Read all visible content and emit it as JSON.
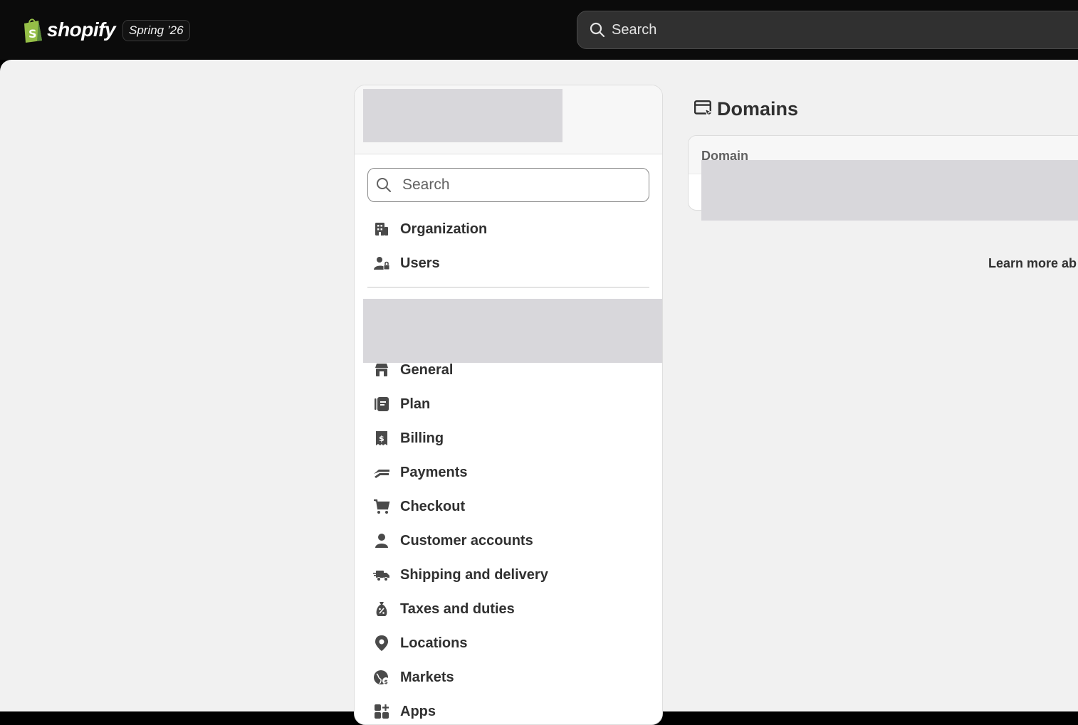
{
  "topbar": {
    "logo_text": "shopify",
    "edition_badge": "Spring ’26",
    "search_placeholder": "Search"
  },
  "settings": {
    "search_placeholder": "Search",
    "org_items": [
      {
        "label": "Organization",
        "icon": "building-icon"
      },
      {
        "label": "Users",
        "icon": "users-lock-icon"
      }
    ],
    "store_items": [
      {
        "label": "General",
        "icon": "store-icon"
      },
      {
        "label": "Plan",
        "icon": "plan-icon"
      },
      {
        "label": "Billing",
        "icon": "billing-receipt-icon"
      },
      {
        "label": "Payments",
        "icon": "payments-icon"
      },
      {
        "label": "Checkout",
        "icon": "cart-icon"
      },
      {
        "label": "Customer accounts",
        "icon": "person-icon"
      },
      {
        "label": "Shipping and delivery",
        "icon": "delivery-truck-icon"
      },
      {
        "label": "Taxes and duties",
        "icon": "tax-bag-icon"
      },
      {
        "label": "Locations",
        "icon": "location-pin-icon"
      },
      {
        "label": "Markets",
        "icon": "globe-icon"
      },
      {
        "label": "Apps",
        "icon": "apps-icon"
      }
    ]
  },
  "content": {
    "page_title": "Domains",
    "domain_column_header": "Domain",
    "learn_more_text": "Learn more ab"
  },
  "colors": {
    "topbar_bg": "#0b0b0b",
    "page_bg": "#f1f1f1",
    "text_primary": "#303030",
    "redaction": "#d8d7db"
  }
}
